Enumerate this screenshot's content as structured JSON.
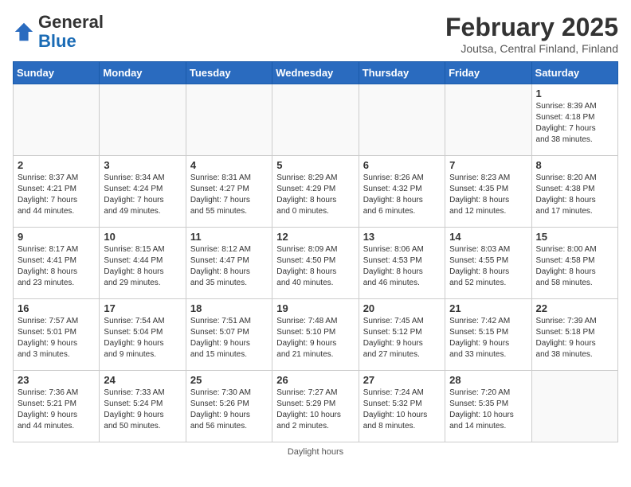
{
  "header": {
    "logo_general": "General",
    "logo_blue": "Blue",
    "month_title": "February 2025",
    "subtitle": "Joutsa, Central Finland, Finland"
  },
  "days_of_week": [
    "Sunday",
    "Monday",
    "Tuesday",
    "Wednesday",
    "Thursday",
    "Friday",
    "Saturday"
  ],
  "footer": {
    "note": "Daylight hours"
  },
  "weeks": [
    [
      {
        "day": "",
        "info": ""
      },
      {
        "day": "",
        "info": ""
      },
      {
        "day": "",
        "info": ""
      },
      {
        "day": "",
        "info": ""
      },
      {
        "day": "",
        "info": ""
      },
      {
        "day": "",
        "info": ""
      },
      {
        "day": "1",
        "info": "Sunrise: 8:39 AM\nSunset: 4:18 PM\nDaylight: 7 hours\nand 38 minutes."
      }
    ],
    [
      {
        "day": "2",
        "info": "Sunrise: 8:37 AM\nSunset: 4:21 PM\nDaylight: 7 hours\nand 44 minutes."
      },
      {
        "day": "3",
        "info": "Sunrise: 8:34 AM\nSunset: 4:24 PM\nDaylight: 7 hours\nand 49 minutes."
      },
      {
        "day": "4",
        "info": "Sunrise: 8:31 AM\nSunset: 4:27 PM\nDaylight: 7 hours\nand 55 minutes."
      },
      {
        "day": "5",
        "info": "Sunrise: 8:29 AM\nSunset: 4:29 PM\nDaylight: 8 hours\nand 0 minutes."
      },
      {
        "day": "6",
        "info": "Sunrise: 8:26 AM\nSunset: 4:32 PM\nDaylight: 8 hours\nand 6 minutes."
      },
      {
        "day": "7",
        "info": "Sunrise: 8:23 AM\nSunset: 4:35 PM\nDaylight: 8 hours\nand 12 minutes."
      },
      {
        "day": "8",
        "info": "Sunrise: 8:20 AM\nSunset: 4:38 PM\nDaylight: 8 hours\nand 17 minutes."
      }
    ],
    [
      {
        "day": "9",
        "info": "Sunrise: 8:17 AM\nSunset: 4:41 PM\nDaylight: 8 hours\nand 23 minutes."
      },
      {
        "day": "10",
        "info": "Sunrise: 8:15 AM\nSunset: 4:44 PM\nDaylight: 8 hours\nand 29 minutes."
      },
      {
        "day": "11",
        "info": "Sunrise: 8:12 AM\nSunset: 4:47 PM\nDaylight: 8 hours\nand 35 minutes."
      },
      {
        "day": "12",
        "info": "Sunrise: 8:09 AM\nSunset: 4:50 PM\nDaylight: 8 hours\nand 40 minutes."
      },
      {
        "day": "13",
        "info": "Sunrise: 8:06 AM\nSunset: 4:53 PM\nDaylight: 8 hours\nand 46 minutes."
      },
      {
        "day": "14",
        "info": "Sunrise: 8:03 AM\nSunset: 4:55 PM\nDaylight: 8 hours\nand 52 minutes."
      },
      {
        "day": "15",
        "info": "Sunrise: 8:00 AM\nSunset: 4:58 PM\nDaylight: 8 hours\nand 58 minutes."
      }
    ],
    [
      {
        "day": "16",
        "info": "Sunrise: 7:57 AM\nSunset: 5:01 PM\nDaylight: 9 hours\nand 3 minutes."
      },
      {
        "day": "17",
        "info": "Sunrise: 7:54 AM\nSunset: 5:04 PM\nDaylight: 9 hours\nand 9 minutes."
      },
      {
        "day": "18",
        "info": "Sunrise: 7:51 AM\nSunset: 5:07 PM\nDaylight: 9 hours\nand 15 minutes."
      },
      {
        "day": "19",
        "info": "Sunrise: 7:48 AM\nSunset: 5:10 PM\nDaylight: 9 hours\nand 21 minutes."
      },
      {
        "day": "20",
        "info": "Sunrise: 7:45 AM\nSunset: 5:12 PM\nDaylight: 9 hours\nand 27 minutes."
      },
      {
        "day": "21",
        "info": "Sunrise: 7:42 AM\nSunset: 5:15 PM\nDaylight: 9 hours\nand 33 minutes."
      },
      {
        "day": "22",
        "info": "Sunrise: 7:39 AM\nSunset: 5:18 PM\nDaylight: 9 hours\nand 38 minutes."
      }
    ],
    [
      {
        "day": "23",
        "info": "Sunrise: 7:36 AM\nSunset: 5:21 PM\nDaylight: 9 hours\nand 44 minutes."
      },
      {
        "day": "24",
        "info": "Sunrise: 7:33 AM\nSunset: 5:24 PM\nDaylight: 9 hours\nand 50 minutes."
      },
      {
        "day": "25",
        "info": "Sunrise: 7:30 AM\nSunset: 5:26 PM\nDaylight: 9 hours\nand 56 minutes."
      },
      {
        "day": "26",
        "info": "Sunrise: 7:27 AM\nSunset: 5:29 PM\nDaylight: 10 hours\nand 2 minutes."
      },
      {
        "day": "27",
        "info": "Sunrise: 7:24 AM\nSunset: 5:32 PM\nDaylight: 10 hours\nand 8 minutes."
      },
      {
        "day": "28",
        "info": "Sunrise: 7:20 AM\nSunset: 5:35 PM\nDaylight: 10 hours\nand 14 minutes."
      },
      {
        "day": "",
        "info": ""
      }
    ]
  ]
}
